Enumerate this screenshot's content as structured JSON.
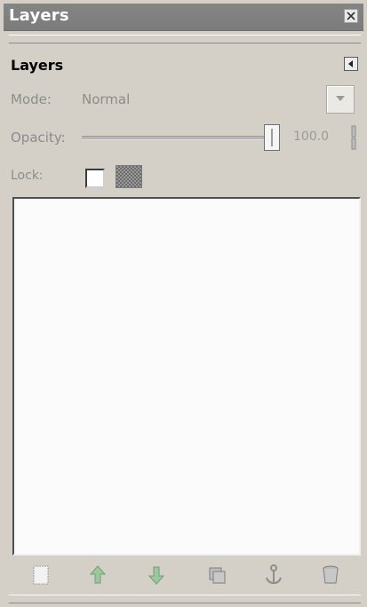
{
  "window": {
    "title": "Layers"
  },
  "panel": {
    "title": "Layers"
  },
  "mode": {
    "label": "Mode:",
    "value": "Normal"
  },
  "opacity": {
    "label": "Opacity:",
    "value": "100.0"
  },
  "lock": {
    "label": "Lock:"
  },
  "layers": [],
  "toolbar": {
    "buttons": [
      {
        "icon": "new-layer-icon"
      },
      {
        "icon": "raise-layer-icon"
      },
      {
        "icon": "lower-layer-icon"
      },
      {
        "icon": "duplicate-layer-icon"
      },
      {
        "icon": "anchor-layer-icon"
      },
      {
        "icon": "delete-layer-icon"
      }
    ]
  },
  "colors": {
    "titlebar": "#7b7b7b",
    "background": "#d4d0c8",
    "disabled_text": "#8c8c8c",
    "arrow_green": "#8cbf8c"
  }
}
